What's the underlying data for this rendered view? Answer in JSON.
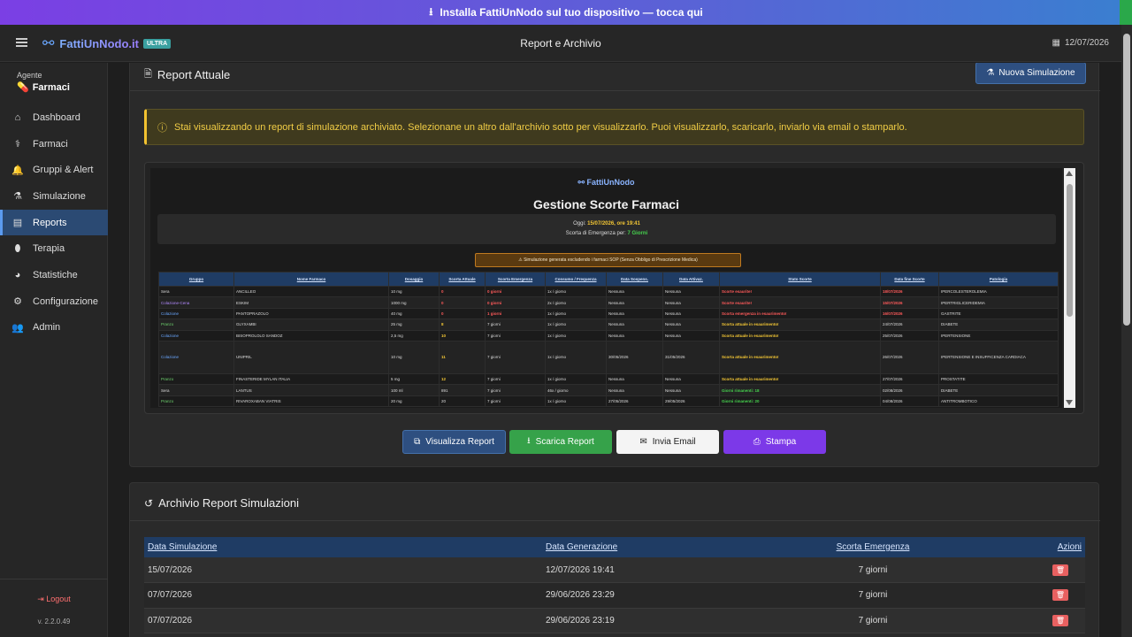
{
  "banner": {
    "text": "Installa FattiUnNodo sul tuo dispositivo — tocca qui",
    "icon": "download-icon"
  },
  "header": {
    "brand": "FattiUnNodo.it",
    "badge": "ULTRA",
    "title": "Report e Archivio",
    "date": "12/07/2026"
  },
  "sidebar": {
    "agent_label": "Agente",
    "agent_value": "Farmaci",
    "items": [
      {
        "label": "Dashboard",
        "icon": "home-icon"
      },
      {
        "label": "Farmaci",
        "icon": "pills-icon"
      },
      {
        "label": "Gruppi & Alert",
        "icon": "bell-icon"
      },
      {
        "label": "Simulazione",
        "icon": "flask-icon"
      },
      {
        "label": "Reports",
        "icon": "chart-icon"
      },
      {
        "label": "Terapia",
        "icon": "capsule-icon"
      },
      {
        "label": "Statistiche",
        "icon": "pie-icon"
      },
      {
        "label": "Configurazione",
        "icon": "gear-icon"
      },
      {
        "label": "Admin",
        "icon": "users-icon"
      }
    ],
    "logout": "Logout",
    "version": "v. 2.2.0.49"
  },
  "report": {
    "title": "Report Attuale",
    "new_sim": "Nuova Simulazione",
    "alert": "Stai visualizzando un report di simulazione archiviato. Selezionane un altro dall'archivio sotto per visualizzarlo. Puoi visualizzarlo, scaricarlo, inviarlo via email o stamparlo.",
    "buttons": {
      "view": "Visualizza Report",
      "download": "Scarica Report",
      "email": "Invia Email",
      "print": "Stampa"
    }
  },
  "preview": {
    "logo": "FattiUnNodo",
    "title": "Gestione Scorte Farmaci",
    "today_label": "Oggi:",
    "today_value": "15/07/2026, ore 19:41",
    "emergency_label": "Scorta di Emergenza per:",
    "emergency_value": "7 Giorni",
    "warning": "⚠ Simulazione generata escludendo i farmaci SOP (Senza Obbligo di Prescrizione Medica)",
    "headers": [
      "Gruppo",
      "Nome Farmaco",
      "Dosaggio",
      "Scorta Attuale",
      "Scorta Emergenza",
      "Consumo / Frequenza",
      "Data Sospens.",
      "Data Attivaz.",
      "Stato Scorte",
      "Data fine Scorte",
      "Patologia"
    ],
    "rows": [
      [
        "Sera",
        "ANCILLEO",
        "10 mg",
        "0",
        "0 giorni",
        "1x / giorno",
        "Nessuna",
        "Nessuna",
        "Scorte esaurite!",
        "18/07/2026",
        "IPERCOLESTEROLEMIA"
      ],
      [
        "Colazione-Cena",
        "ESKIM",
        "1000 mg",
        "0",
        "0 giorni",
        "2x / giorno",
        "Nessuna",
        "Nessuna",
        "Scorte esaurite!",
        "15/07/2026",
        "IPERTRIGLICERIDEMIA"
      ],
      [
        "Colazione",
        "PANTOPRAZOLO",
        "40 mg",
        "0",
        "1 giorni",
        "1x / giorno",
        "Nessuna",
        "Nessuna",
        "Scorta emergenza in esaurimento!",
        "16/07/2026",
        "GASTRITE"
      ],
      [
        "Pranzo",
        "GLYXAMBI",
        "25 mg",
        "8",
        "7 giorni",
        "1x / giorno",
        "Nessuna",
        "Nessuna",
        "Scorta attuale in esaurimento!",
        "24/07/2026",
        "DIABETE"
      ],
      [
        "Colazione",
        "BISOPROLOLO SANDOZ",
        "2,5 mg",
        "10",
        "7 giorni",
        "1x / giorno",
        "Nessuna",
        "Nessuna",
        "Scorta attuale in esaurimento!",
        "25/07/2026",
        "IPERTENSIONE"
      ],
      [
        "Colazione",
        "UNIPRIL",
        "10 mg",
        "11",
        "7 giorni",
        "1x / giorno",
        "30/05/2026",
        "31/05/2026",
        "Scorta attuale in esaurimento!",
        "26/07/2026",
        "IPERTENSIONE E INSUFFICENZA CARDIACA"
      ],
      [
        "Pranzo",
        "FINASTERIDE MYLAN ITALIA",
        "5 mg",
        "12",
        "7 giorni",
        "1x / giorno",
        "Nessuna",
        "Nessuna",
        "Scorta attuale in esaurimento!",
        "27/07/2026",
        "PROSTATITE"
      ],
      [
        "Sera",
        "LANTUS",
        "100 ml",
        "891",
        "7 giorni",
        "46x / giorno",
        "Nessuna",
        "Nessuna",
        "Giorni rimanenti: 18",
        "02/08/2026",
        "DIABETE"
      ],
      [
        "Pranzo",
        "RIVAROXABAN VIATRIS",
        "20 mg",
        "20",
        "7 giorni",
        "1x / giorno",
        "27/05/2026",
        "29/05/2026",
        "Giorni rimanenti: 20",
        "04/08/2026",
        "ANTITROMBOTICO"
      ]
    ]
  },
  "archive": {
    "title": "Archivio Report Simulazioni",
    "headers": [
      "Data Simulazione",
      "Data Generazione",
      "Scorta Emergenza",
      "Azioni"
    ],
    "rows": [
      [
        "15/07/2026",
        "12/07/2026 19:41",
        "7 giorni"
      ],
      [
        "07/07/2026",
        "29/06/2026 23:29",
        "7 giorni"
      ],
      [
        "07/07/2026",
        "29/06/2026 23:19",
        "7 giorni"
      ]
    ]
  },
  "colors": {
    "accent": "#2e4f80",
    "download": "#36a24a",
    "print": "#7c39e8",
    "alert_text": "#f1cd45",
    "danger": "#e86060"
  }
}
